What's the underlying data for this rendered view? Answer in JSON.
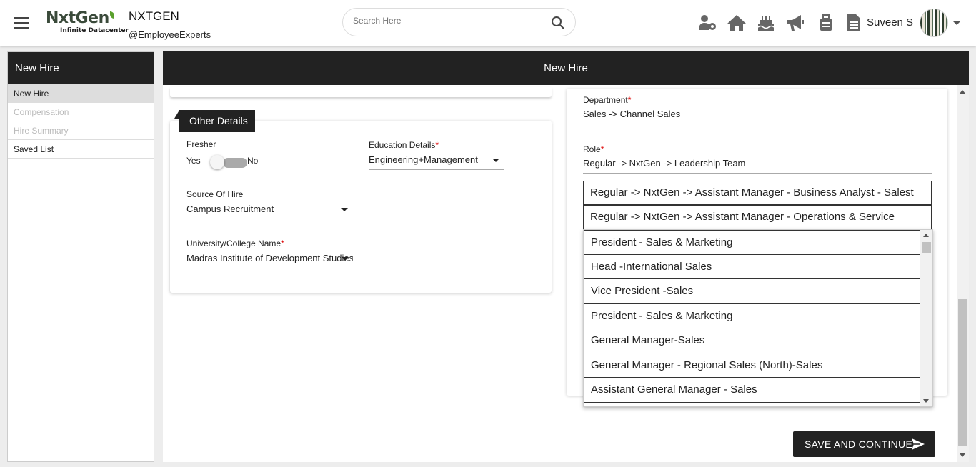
{
  "header": {
    "logo_text": "NxtGen",
    "logo_subtitle": "Infinite Datacenter",
    "company_name": "NXTGEN",
    "company_handle": "@EmployeeExperts",
    "search_placeholder": "Search Here",
    "user_name": "Suveen S",
    "icons": [
      "team-settings-icon",
      "home-icon",
      "birthday-cake-icon",
      "megaphone-icon",
      "briefcase-icon",
      "document-icon"
    ]
  },
  "sidebar": {
    "title": "New Hire",
    "items": [
      {
        "label": "New Hire",
        "state": "active"
      },
      {
        "label": "Compensation",
        "state": "disabled"
      },
      {
        "label": "Hire Summary",
        "state": "disabled"
      },
      {
        "label": "Saved List",
        "state": "normal"
      }
    ]
  },
  "main": {
    "title": "New Hire",
    "other_details": {
      "title": "Other Details",
      "fresher_label": "Fresher",
      "fresher_yes": "Yes",
      "fresher_no": "No",
      "education_label": "Education Details",
      "education_value": "Engineering+Management",
      "source_label": "Source Of Hire",
      "source_value": "Campus Recruitment",
      "university_label": "University/College Name",
      "university_value": "Madras Institute of Development Studies"
    },
    "department_label": "Department",
    "department_value": "Sales -> Channel Sales",
    "role_label": "Role",
    "role_value": "Regular -> NxtGen -> Leadership Team",
    "role_options": [
      "Regular -> NxtGen -> Assistant Manager - Business Analyst - Salest",
      "Regular -> NxtGen -> Assistant Manager - Operations & Service"
    ],
    "dropdown_items": [
      "President - Sales & Marketing",
      "Head -International Sales",
      "Vice President -Sales",
      "President - Sales & Marketing",
      "General Manager-Sales",
      "General Manager - Regional Sales (North)-Sales",
      "Assistant General Manager - Sales"
    ],
    "save_button": "SAVE AND CONTINUE"
  }
}
